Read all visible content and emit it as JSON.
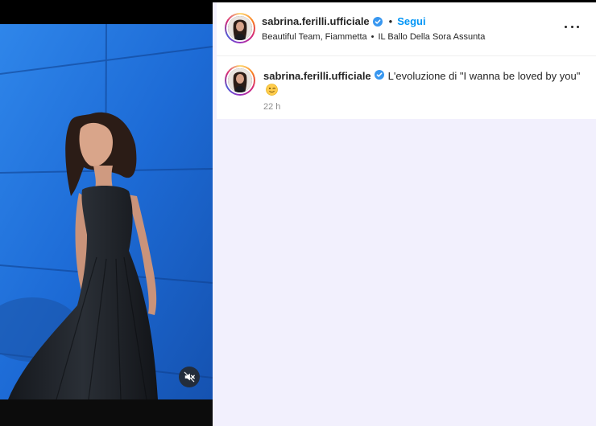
{
  "media": {
    "image_subject": "woman-in-black-dress-against-blue-wall",
    "mute_icon": "speaker-muted-icon"
  },
  "post": {
    "header": {
      "username": "sabrina.ferilli.ufficiale",
      "dot": "•",
      "follow_label": "Segui",
      "subtitle_part1": "Beautiful Team, Fiammetta",
      "subtitle_separator": "•",
      "subtitle_part2": "IL Ballo Della Sora Assunta",
      "more_icon": "more-options-icon"
    },
    "caption": {
      "username": "sabrina.ferilli.ufficiale",
      "text": "L'evoluzione di \"I wanna be loved by you\"",
      "emoji": "winking-face-emoji",
      "timestamp": "22 h"
    }
  },
  "colors": {
    "follow_blue": "#0095f6",
    "verified_blue": "#3897f0",
    "panel_background": "#f2f0fd",
    "wall_blue": "#1f6fd8"
  }
}
